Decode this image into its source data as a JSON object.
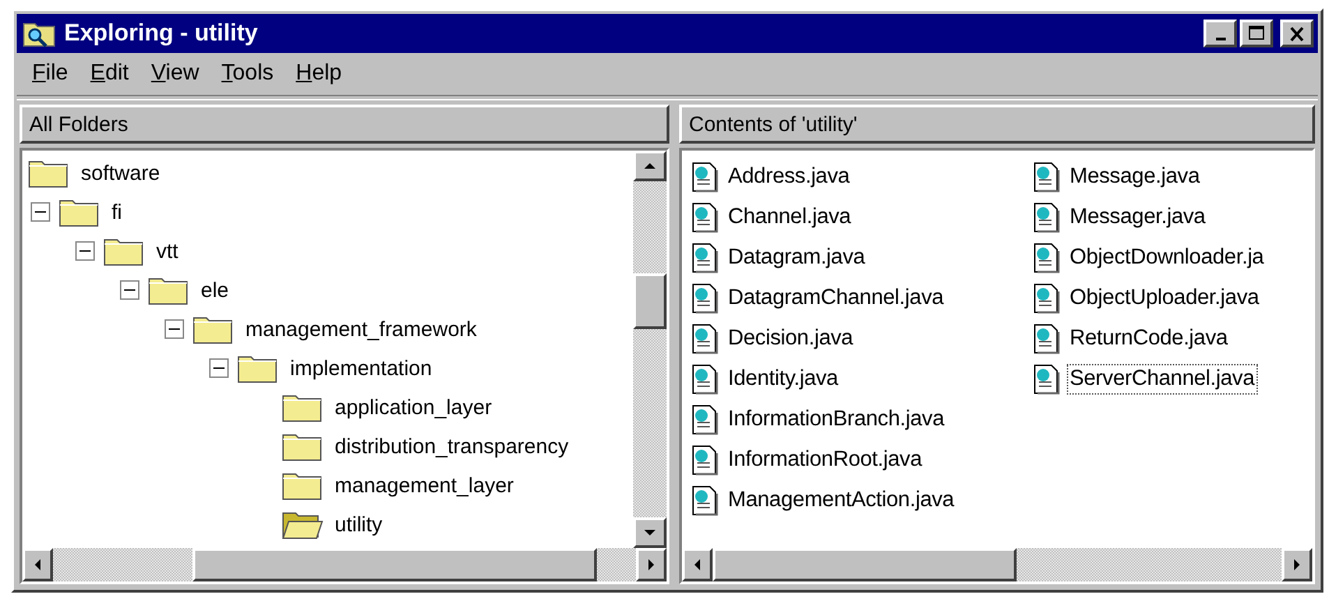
{
  "window": {
    "title": "Exploring - utility"
  },
  "menu": [
    {
      "label": "File"
    },
    {
      "label": "Edit"
    },
    {
      "label": "View"
    },
    {
      "label": "Tools"
    },
    {
      "label": "Help"
    }
  ],
  "folders_pane": {
    "header": "All Folders",
    "tree": [
      {
        "label": "software",
        "selected": false,
        "children": [
          {
            "label": "fi",
            "selected": false,
            "expanded": true,
            "children": [
              {
                "label": "vtt",
                "selected": false,
                "expanded": true,
                "children": [
                  {
                    "label": "ele",
                    "selected": false,
                    "expanded": true,
                    "children": [
                      {
                        "label": "management_framework",
                        "selected": false,
                        "expanded": true,
                        "children": [
                          {
                            "label": "implementation",
                            "selected": false,
                            "expanded": true,
                            "children": [
                              {
                                "label": "application_layer",
                                "selected": false
                              },
                              {
                                "label": "distribution_transparency",
                                "selected": false
                              },
                              {
                                "label": "management_layer",
                                "selected": false
                              },
                              {
                                "label": "utility",
                                "selected": true
                              }
                            ]
                          }
                        ]
                      }
                    ]
                  }
                ]
              }
            ]
          }
        ]
      }
    ]
  },
  "contents_pane": {
    "header": "Contents of 'utility'",
    "files": [
      {
        "name": "Address.java",
        "focused": false
      },
      {
        "name": "Channel.java",
        "focused": false
      },
      {
        "name": "Datagram.java",
        "focused": false
      },
      {
        "name": "DatagramChannel.java",
        "focused": false
      },
      {
        "name": "Decision.java",
        "focused": false
      },
      {
        "name": "Identity.java",
        "focused": false
      },
      {
        "name": "InformationBranch.java",
        "focused": false
      },
      {
        "name": "InformationRoot.java",
        "focused": false
      },
      {
        "name": "ManagementAction.java",
        "focused": false
      },
      {
        "name": "Message.java",
        "focused": false
      },
      {
        "name": "Messager.java",
        "focused": false
      },
      {
        "name": "ObjectDownloader.ja",
        "focused": false
      },
      {
        "name": "ObjectUploader.java",
        "focused": false
      },
      {
        "name": "ReturnCode.java",
        "focused": false
      },
      {
        "name": "ServerChannel.java",
        "focused": true
      }
    ]
  }
}
